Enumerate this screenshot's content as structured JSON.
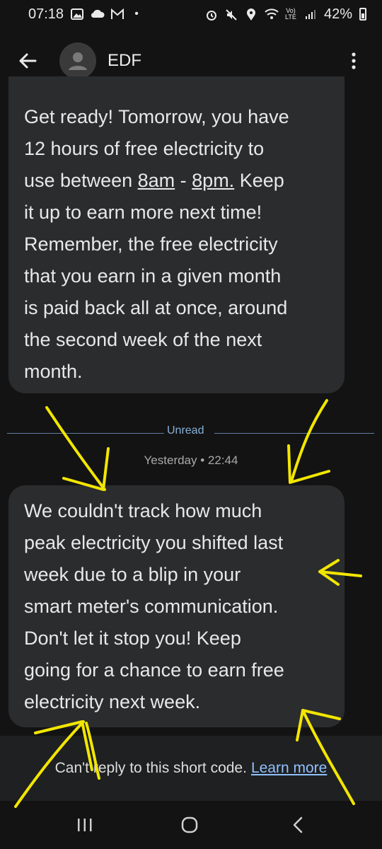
{
  "status_bar": {
    "time": "07:18",
    "battery_percent": "42%",
    "left_icons": [
      "image-icon",
      "cloud-icon",
      "gmail-icon",
      "dot-icon"
    ],
    "right_icons": [
      "alarm-icon",
      "mute-icon",
      "location-icon",
      "wifi-icon",
      "volte-icon",
      "signal-icon",
      "battery-icon"
    ]
  },
  "app_bar": {
    "contact_name": "EDF",
    "icons": [
      "back-arrow-icon",
      "person-avatar-icon",
      "more-vert-icon"
    ]
  },
  "messages": [
    {
      "lines": [
        "Get ready! Tomorrow, you have",
        "12 hours of free electricity to",
        "use between ",
        "8am",
        " - ",
        "8pm.",
        " Keep",
        "it up to earn more next time!",
        "Remember, the free electricity",
        "that you earn in a given month",
        "is paid back all at once, around",
        "the second week of the next",
        "month."
      ]
    },
    {
      "lines": [
        "We couldn't track how much",
        "peak electricity you shifted last",
        "week due to a blip in your",
        "smart meter's communication.",
        "Don't let it stop you! Keep",
        "going for a chance to earn free",
        "electricity next week."
      ]
    }
  ],
  "divider": {
    "label": "Unread"
  },
  "timestamp": "Yesterday • 22:44",
  "footer": {
    "text": "Can't reply to this short code.",
    "link": "Learn more"
  },
  "nav_bar": {
    "icons": [
      "recent-apps-icon",
      "home-icon",
      "back-icon"
    ]
  },
  "colors": {
    "background": "#131313",
    "bubble": "#2b2c2e",
    "annotation": "#f2e600",
    "link": "#8fc1ff",
    "unread": "#86b0d8"
  }
}
